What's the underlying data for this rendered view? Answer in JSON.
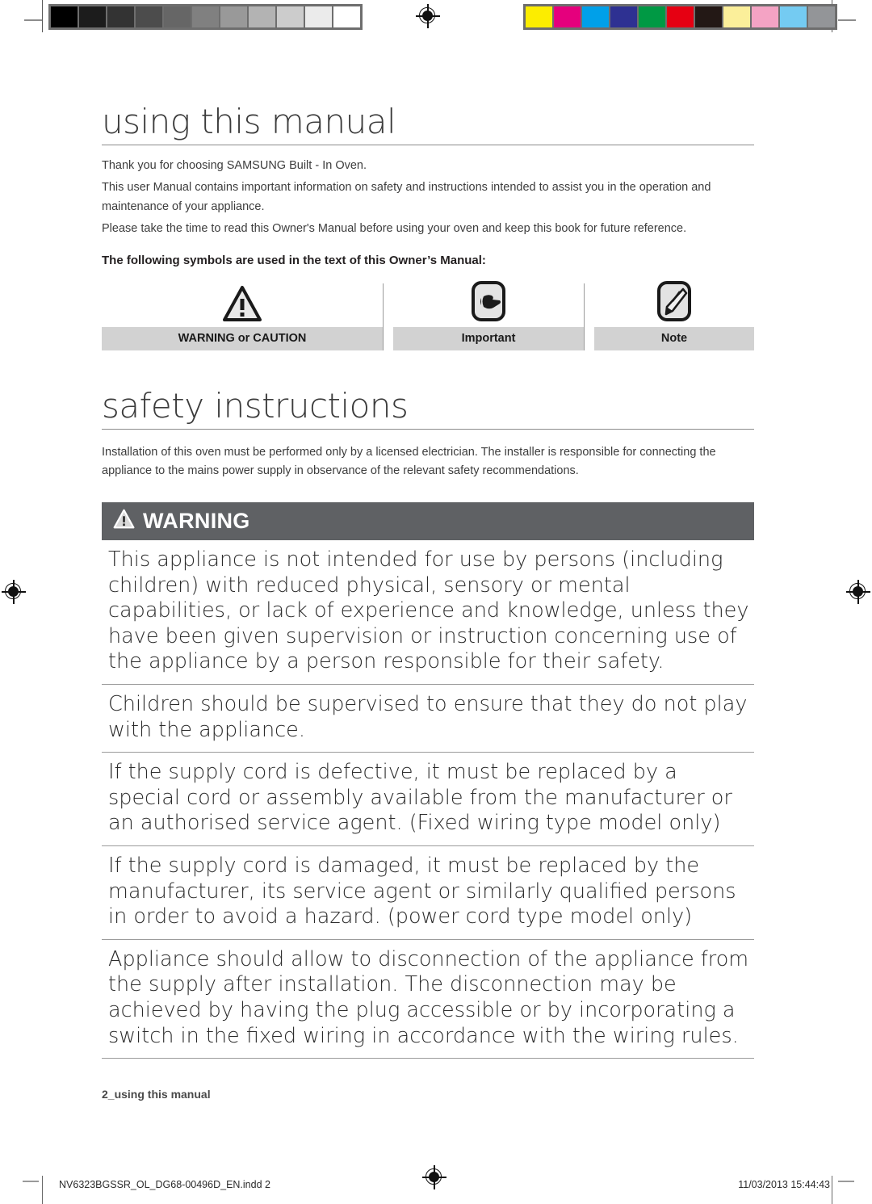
{
  "calibration": {
    "gray_swatches": [
      "#000000",
      "#1c1c1c",
      "#333333",
      "#4c4c4c",
      "#666666",
      "#808080",
      "#999999",
      "#b3b3b3",
      "#cccccc",
      "#ebebeb",
      "#ffffff"
    ],
    "color_swatches": [
      "#fced00",
      "#e5007d",
      "#00a0e9",
      "#2e3192",
      "#009944",
      "#e60012",
      "#231815",
      "#fbef9a",
      "#f4a3c4",
      "#74cbf2",
      "#939598"
    ]
  },
  "document": {
    "manual_section_1": {
      "title": "using this manual",
      "paragraphs": [
        "Thank you for choosing SAMSUNG Built - In Oven.",
        "This user Manual contains important information on safety and instructions intended to assist you in the operation and maintenance of your appliance.",
        "Please take the time to read this Owner's Manual before using your oven and keep this book for future reference."
      ],
      "symbols_lead": "The following symbols are used in the text of this Owner’s Manual:",
      "symbols": [
        {
          "icon": "warning-triangle-icon",
          "label": "WARNING or CAUTION"
        },
        {
          "icon": "pointing-hand-icon",
          "label": "Important"
        },
        {
          "icon": "pencil-icon",
          "label": "Note"
        }
      ]
    },
    "manual_section_2": {
      "title": "safety instructions",
      "intro": "Installation of this oven must be performed only by a licensed electrician. The installer is responsible for connecting the appliance to the mains power supply in observance of the relevant safety recommendations.",
      "warning_banner": {
        "icon": "warning-triangle-icon",
        "label": "WARNING",
        "background": "#5f6164"
      },
      "warnings": [
        "This appliance is not intended for use by persons (including children) with reduced physical, sensory or mental capabilities, or lack of experience and knowledge, unless they have been given supervision or instruction concerning use of the appliance by a person responsible for their safety.",
        "Children should be supervised to ensure that they do not play with the appliance.",
        "If the supply cord is defective, it must be replaced by a special cord or assembly available from the manufacturer or an authorised service agent. (Fixed wiring type model only)",
        "If the supply cord is damaged, it must be replaced by the manufacturer, its service agent or similarly qualified persons in order to avoid a hazard. (power cord type model only)",
        "Appliance should allow to disconnection of the appliance from the supply after installation. The disconnection may be achieved by having the plug accessible or by incorporating a switch in the fixed wiring in accordance with the wiring rules."
      ]
    },
    "page_footer": "2_using this manual"
  },
  "print_bar": {
    "file_name": "NV6323BGSSR_OL_DG68-00496D_EN.indd   2",
    "timestamp": "11/03/2013   15:44:43"
  }
}
